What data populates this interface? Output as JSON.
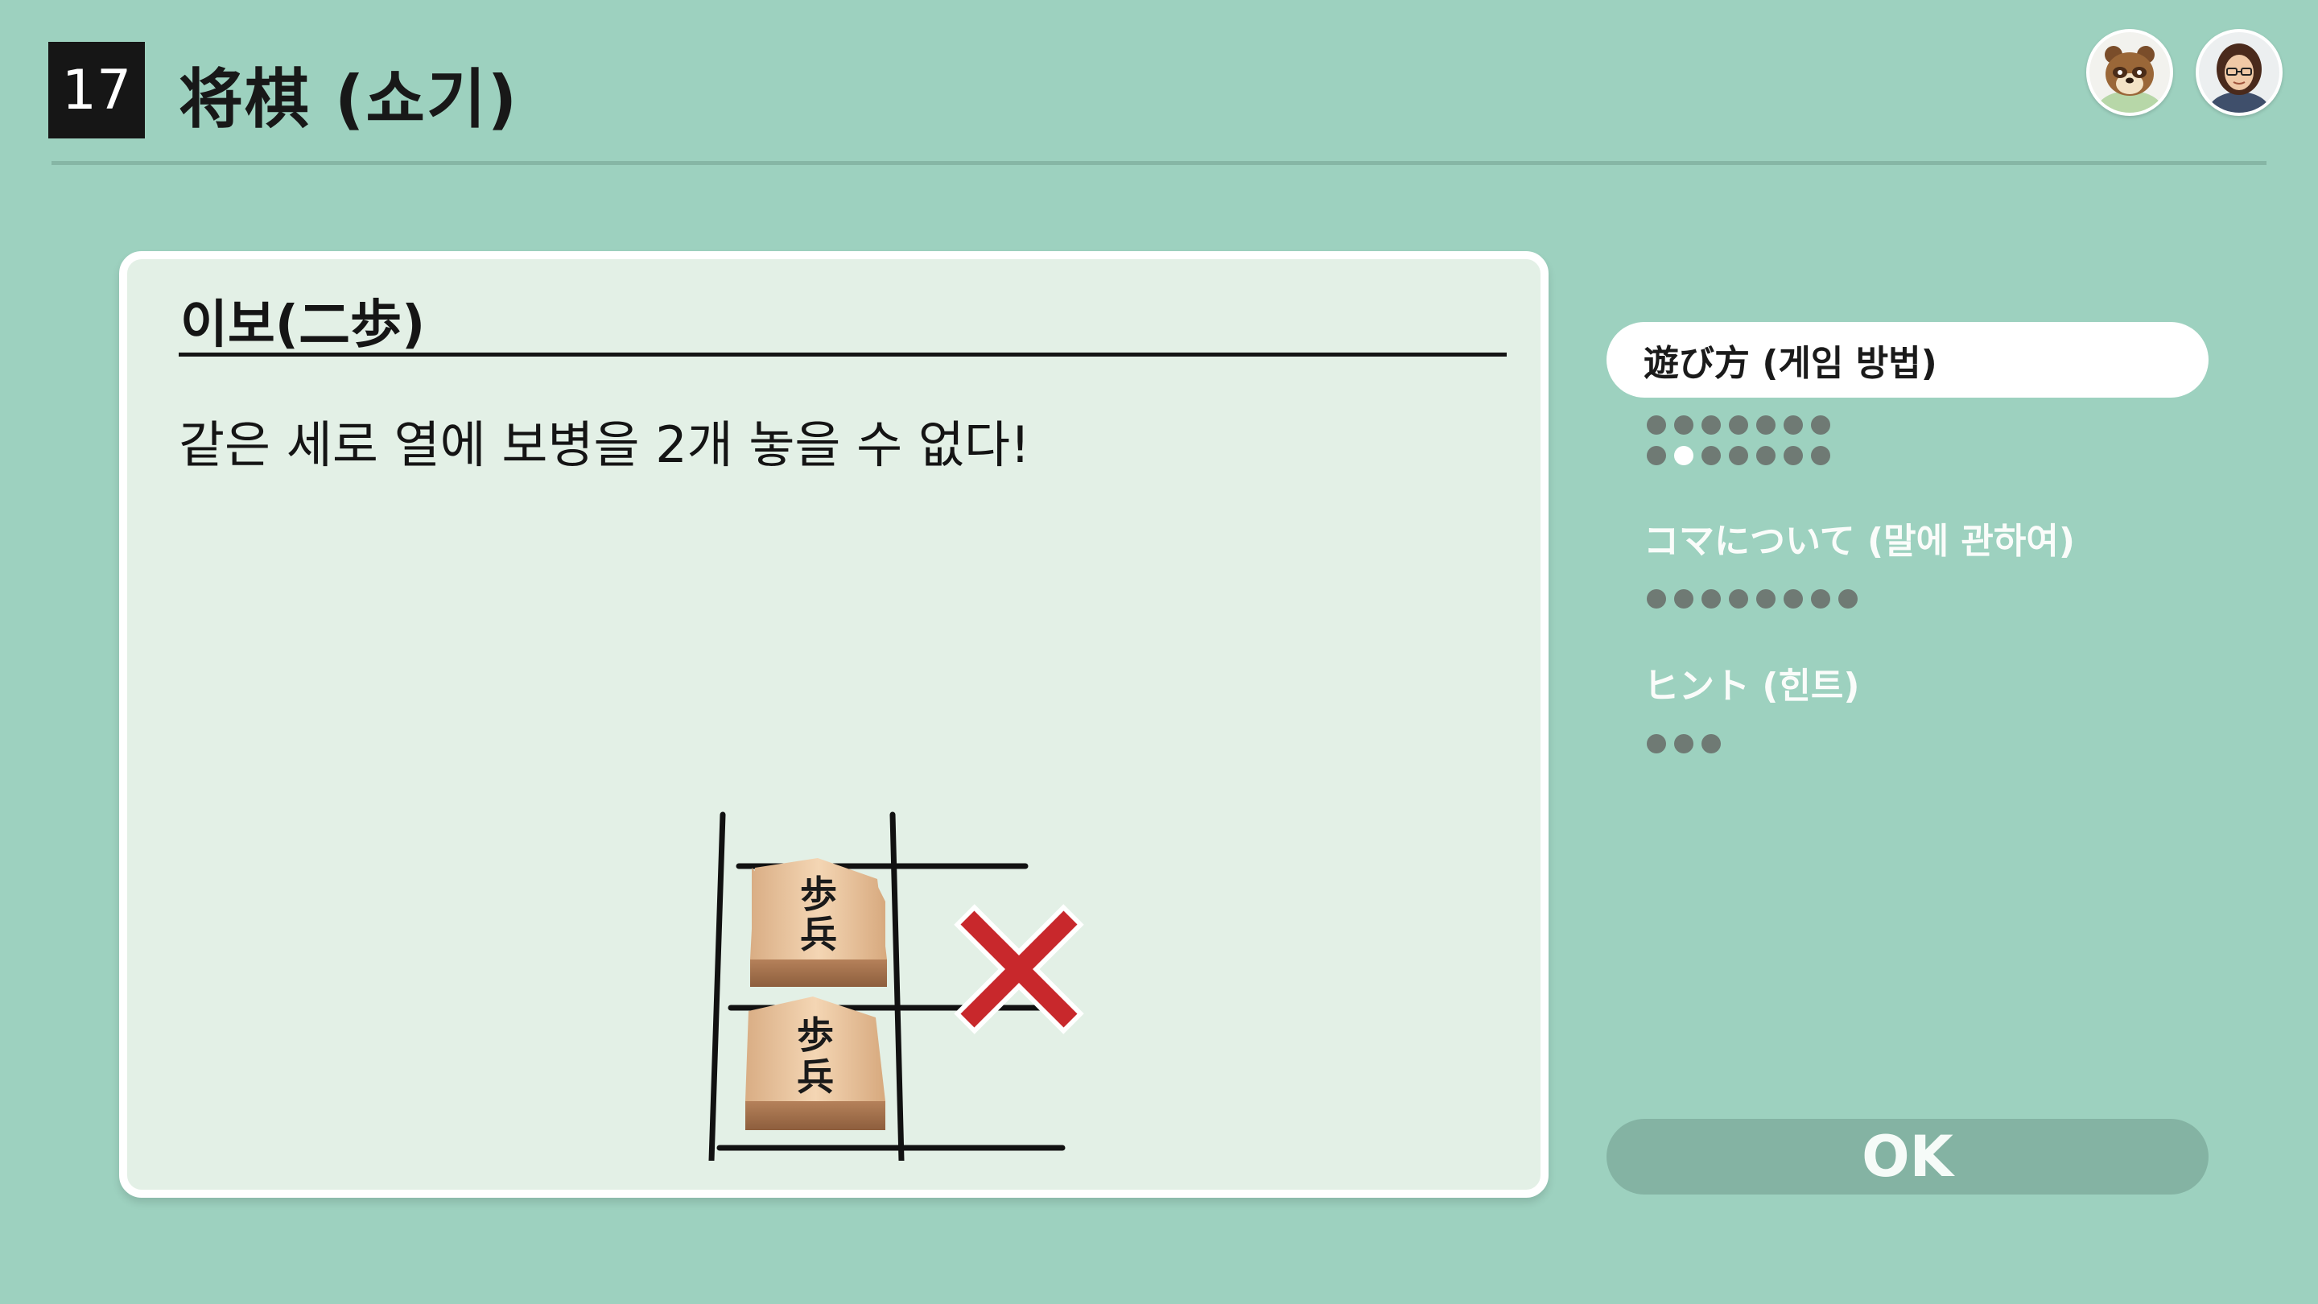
{
  "header": {
    "game_number": "17",
    "game_title": "将棋 (쇼기)"
  },
  "avatars": [
    {
      "name": "tanuki-avatar-icon"
    },
    {
      "name": "user-avatar-icon"
    }
  ],
  "panel": {
    "heading": "이보(二歩)",
    "rule_text": "같은 세로 열에 보병을 2개 놓을 수 없다!",
    "diagram": {
      "piece_text": "歩兵",
      "piece_count": 2,
      "mark": "✕"
    }
  },
  "menu": {
    "items": [
      {
        "label": "遊び方 (게임 방법)",
        "selected": true
      },
      {
        "label": "コマについて (말에 관하여)",
        "selected": false
      },
      {
        "label": "ヒント (힌트)",
        "selected": false
      }
    ]
  },
  "ok_label": "OK",
  "colors": {
    "background": "#9dd1bf",
    "panel": "#e3f0e6",
    "ok_button": "#84b3a3",
    "cross": "#c8282c"
  }
}
